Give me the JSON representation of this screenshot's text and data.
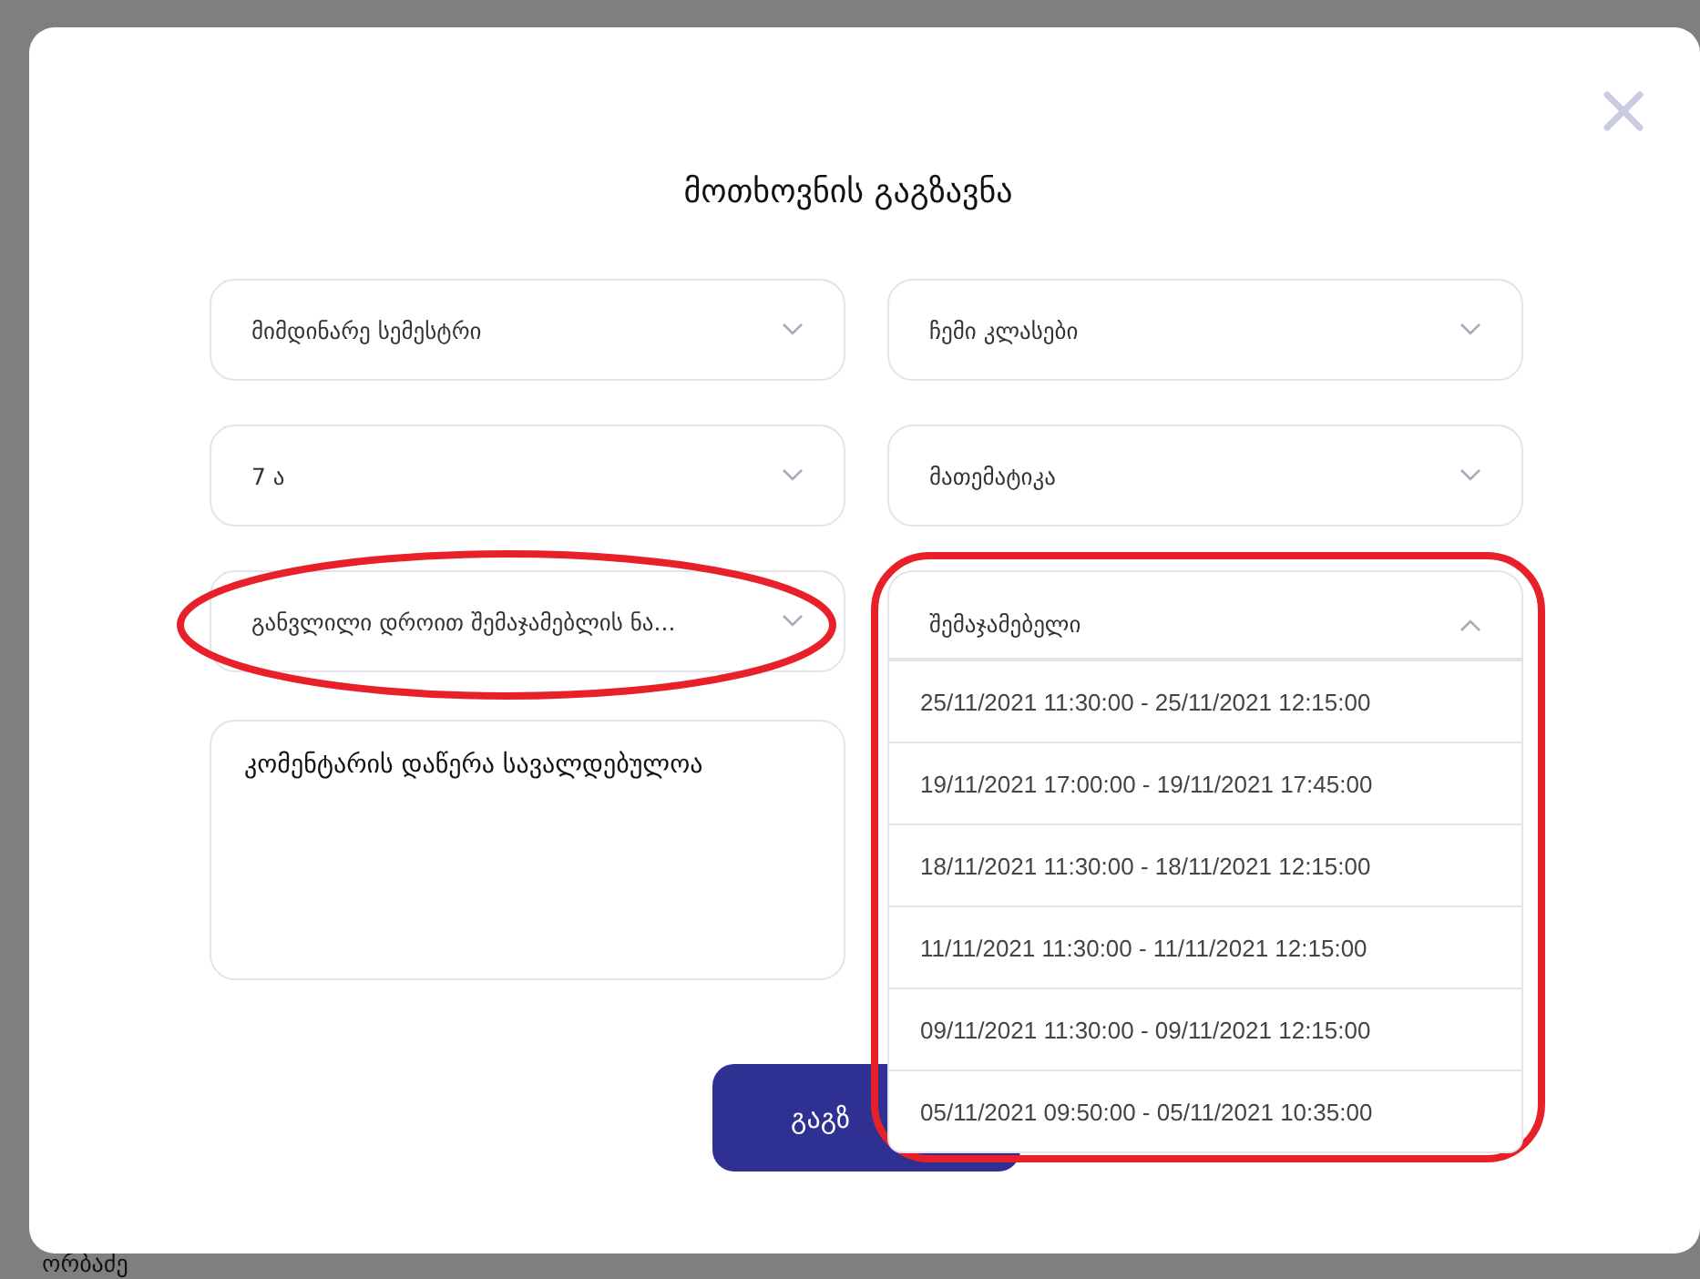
{
  "dialog": {
    "title": "მოთხოვნის გაგზავნა",
    "selects": [
      {
        "value": "მიმდინარე სემესტრი",
        "expanded": false
      },
      {
        "value": "ჩემი კლასები",
        "expanded": false
      },
      {
        "value": "7 ა",
        "expanded": false
      },
      {
        "value": "მათემატიკა",
        "expanded": false
      },
      {
        "value": "განვლილი დროით შემაჯამებლის ნა...",
        "expanded": false
      },
      {
        "value": "შემაჯამებელი",
        "expanded": true,
        "options": [
          "25/11/2021 11:30:00 - 25/11/2021 12:15:00",
          "19/11/2021 17:00:00 - 19/11/2021 17:45:00",
          "18/11/2021 11:30:00 - 18/11/2021 12:15:00",
          "11/11/2021 11:30:00 - 11/11/2021 12:15:00",
          "09/11/2021 11:30:00 - 09/11/2021 12:15:00",
          "05/11/2021 09:50:00 - 05/11/2021 10:35:00"
        ]
      }
    ],
    "comment": {
      "placeholder": "კომენტარის დაწერა სავალდებულოა"
    },
    "submit_button": "გაგზ"
  },
  "background": {
    "text": "ორბაძე"
  }
}
